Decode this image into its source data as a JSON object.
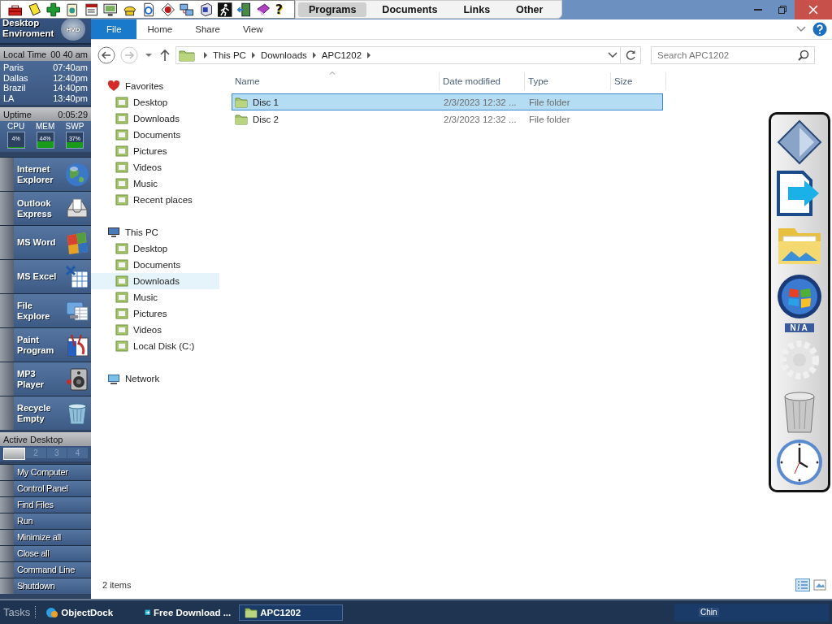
{
  "toolbar": {
    "help_glyph": "?",
    "tabs": [
      {
        "label": "Programs",
        "selected": true
      },
      {
        "label": "Documents",
        "selected": false
      },
      {
        "label": "Links",
        "selected": false
      },
      {
        "label": "Other",
        "selected": false
      }
    ]
  },
  "sidebar": {
    "title": "Desktop Enviroment",
    "logo_text": "HVD",
    "local_time": {
      "label": "Local Time",
      "value": "00 40 am"
    },
    "clocks": [
      {
        "city": "Paris",
        "time": "07:40am"
      },
      {
        "city": "Dallas",
        "time": "12:40pm"
      },
      {
        "city": "Brazil",
        "time": "14:40pm"
      },
      {
        "city": "LA",
        "time": "13:40pm"
      }
    ],
    "uptime": {
      "label": "Uptime",
      "value": "0:05:29"
    },
    "meters": [
      {
        "name": "CPU",
        "reading": "4%"
      },
      {
        "name": "MEM",
        "reading": "44%"
      },
      {
        "name": "SWP",
        "reading": "37%"
      }
    ],
    "launchers": [
      {
        "label": "Internet Explorer"
      },
      {
        "label": "Outlook Express"
      },
      {
        "label": "MS Word"
      },
      {
        "label": "MS Excel"
      },
      {
        "label": "File Explore"
      },
      {
        "label": "Paint Program"
      },
      {
        "label": "MP3 Player"
      },
      {
        "label": "Recycle Empty"
      }
    ],
    "active_desktop": {
      "label": "Active Desktop",
      "desktops": [
        {
          "selected": true
        },
        {
          "label": "2",
          "selected": false
        },
        {
          "label": "3",
          "selected": false
        },
        {
          "label": "4",
          "selected": false
        }
      ]
    },
    "quick_menu": [
      "My Computer",
      "Control Panel",
      "Find Files",
      "Run",
      "Minimize all",
      "Close all",
      "Command Line",
      "Shutdown"
    ]
  },
  "explorer": {
    "ribbon_tabs": [
      {
        "label": "File",
        "kind": "file"
      },
      {
        "label": "Home",
        "kind": "tab"
      },
      {
        "label": "Share",
        "kind": "tab"
      },
      {
        "label": "View",
        "kind": "tab"
      }
    ],
    "address": {
      "crumbs": [
        "This PC",
        "Downloads",
        "APC1202"
      ]
    },
    "search": {
      "placeholder": "Search APC1202"
    },
    "nav": [
      {
        "label": "Favorites",
        "selected": false,
        "children": [
          {
            "label": "Desktop",
            "selected": false
          },
          {
            "label": "Downloads",
            "selected": false
          },
          {
            "label": "Documents",
            "selected": false
          },
          {
            "label": "Pictures",
            "selected": false
          },
          {
            "label": "Videos",
            "selected": false
          },
          {
            "label": "Music",
            "selected": false
          },
          {
            "label": "Recent places",
            "selected": false
          }
        ]
      },
      {
        "label": "This PC",
        "selected": false,
        "children": [
          {
            "label": "Desktop",
            "selected": false
          },
          {
            "label": "Documents",
            "selected": false
          },
          {
            "label": "Downloads",
            "selected": true
          },
          {
            "label": "Music",
            "selected": false
          },
          {
            "label": "Pictures",
            "selected": false
          },
          {
            "label": "Videos",
            "selected": false
          },
          {
            "label": "Local Disk (C:)",
            "selected": false
          }
        ]
      },
      {
        "label": "Network",
        "selected": false
      }
    ],
    "columns": [
      "Name",
      "Date modified",
      "Type",
      "Size"
    ],
    "rows": [
      {
        "name": "Disc 1",
        "date": "2/3/2023 12:32 ...",
        "type": "File folder",
        "selected": true
      },
      {
        "name": "Disc 2",
        "date": "2/3/2023 12:32 ...",
        "type": "File folder",
        "selected": false
      }
    ],
    "status": "2 items"
  },
  "dock": {
    "badge": "N/A"
  },
  "taskbar": {
    "label": "Tasks",
    "tasks": [
      {
        "label": "ObjectDock",
        "selected": false
      },
      {
        "label": "Free Download ...",
        "selected": false
      },
      {
        "label": "APC1202",
        "selected": true
      }
    ],
    "tray_text": "Chin"
  }
}
